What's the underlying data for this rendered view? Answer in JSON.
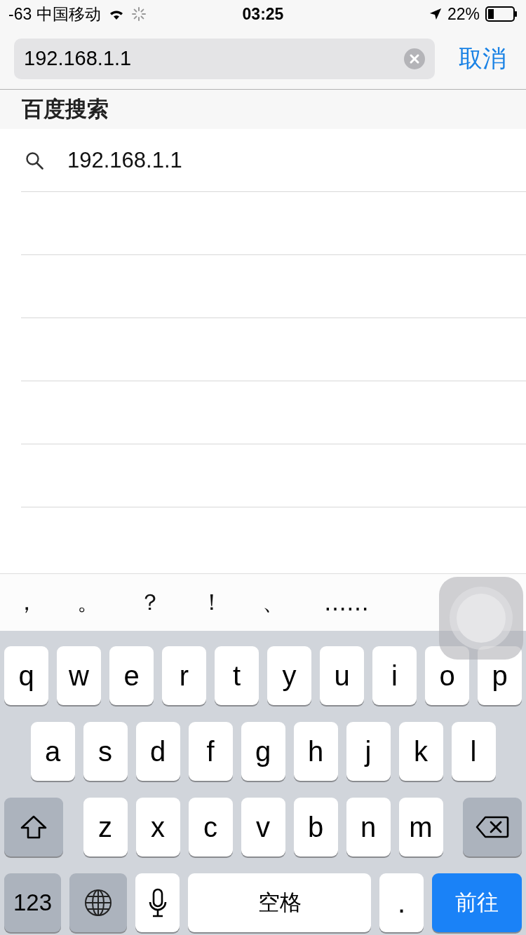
{
  "status_bar": {
    "carrier": "-63 中国移动",
    "time": "03:25",
    "battery": "22%"
  },
  "search": {
    "value": "192.168.1.1",
    "cancel": "取消"
  },
  "section": {
    "title": "百度搜索"
  },
  "results": [
    {
      "text": "192.168.1.1"
    }
  ],
  "candidates": [
    "，",
    "。",
    "？",
    "！",
    "、",
    "……"
  ],
  "keyboard": {
    "rows": [
      {
        "keys": [
          {
            "kind": "char",
            "label": "q"
          },
          {
            "kind": "char",
            "label": "w"
          },
          {
            "kind": "char",
            "label": "e"
          },
          {
            "kind": "char",
            "label": "r"
          },
          {
            "kind": "char",
            "label": "t"
          },
          {
            "kind": "char",
            "label": "y"
          },
          {
            "kind": "char",
            "label": "u"
          },
          {
            "kind": "char",
            "label": "i"
          },
          {
            "kind": "char",
            "label": "o"
          },
          {
            "kind": "char",
            "label": "p"
          }
        ]
      },
      {
        "keys": [
          {
            "kind": "char",
            "label": "a"
          },
          {
            "kind": "char",
            "label": "s"
          },
          {
            "kind": "char",
            "label": "d"
          },
          {
            "kind": "char",
            "label": "f"
          },
          {
            "kind": "char",
            "label": "g"
          },
          {
            "kind": "char",
            "label": "h"
          },
          {
            "kind": "char",
            "label": "j"
          },
          {
            "kind": "char",
            "label": "k"
          },
          {
            "kind": "char",
            "label": "l"
          }
        ]
      },
      {
        "keys": [
          {
            "kind": "shift"
          },
          {
            "kind": "char",
            "label": "z"
          },
          {
            "kind": "char",
            "label": "x"
          },
          {
            "kind": "char",
            "label": "c"
          },
          {
            "kind": "char",
            "label": "v"
          },
          {
            "kind": "char",
            "label": "b"
          },
          {
            "kind": "char",
            "label": "n"
          },
          {
            "kind": "char",
            "label": "m"
          },
          {
            "kind": "delete"
          }
        ]
      },
      {
        "keys": [
          {
            "kind": "numbers",
            "label": "123"
          },
          {
            "kind": "globe"
          },
          {
            "kind": "mic"
          },
          {
            "kind": "space",
            "label": "空格"
          },
          {
            "kind": "char",
            "label": "."
          },
          {
            "kind": "go",
            "label": "前往"
          }
        ]
      }
    ]
  }
}
